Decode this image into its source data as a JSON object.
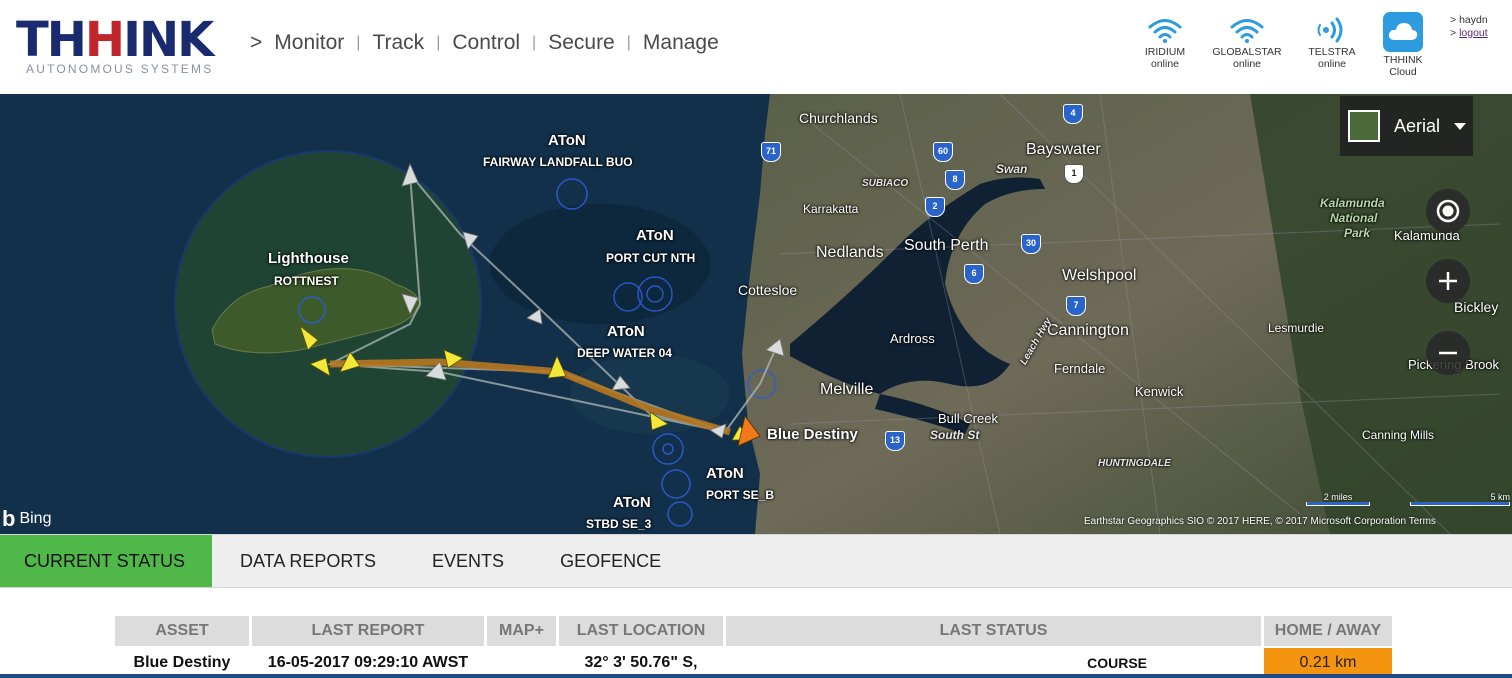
{
  "logo": {
    "name_blue_1": "TH",
    "name_red": "H",
    "name_blue_2": "INK",
    "subtitle": "AUTONOMOUS SYSTEMS"
  },
  "nav": {
    "arrow": ">",
    "items": [
      "Monitor",
      "Track",
      "Control",
      "Secure",
      "Manage"
    ],
    "separator": "|"
  },
  "networks": [
    {
      "name": "IRIDIUM",
      "status": "online",
      "icon": "wifi-icon"
    },
    {
      "name": "GLOBALSTAR",
      "status": "online",
      "icon": "wifi-icon"
    },
    {
      "name": "TELSTRA",
      "status": "online",
      "icon": "broadcast-icon"
    },
    {
      "name": "THHINK",
      "status": "Cloud",
      "icon": "cloud-icon"
    }
  ],
  "user": {
    "name": "haydn",
    "logout_marker": ">",
    "logout": "logout"
  },
  "map": {
    "map_type": "Aerial",
    "provider": "Bing",
    "copyright": "Earthstar Geographics SIO © 2017 HERE, © 2017 Microsoft Corporation  Terms",
    "scale_miles": "2 miles",
    "scale_km": "5 km",
    "aton_label": "AToN",
    "markers": {
      "fairway": "FAIRWAY LANDFALL BUO",
      "port_cut": "PORT CUT NTH",
      "deep_water": "DEEP WATER 04",
      "port_se": "PORT SE_B",
      "stbd_se": "STBD SE_3",
      "lighthouse_title": "Lighthouse",
      "lighthouse_name": "ROTTNEST",
      "vessel": "Blue Destiny"
    },
    "places": {
      "churchlands": "Churchlands",
      "bayswater": "Bayswater",
      "swan": "Swan",
      "subiaco": "SUBIACO",
      "karrakatta": "Karrakatta",
      "nedlands": "Nedlands",
      "south_perth": "South Perth",
      "kalamunda_np_1": "Kalamunda",
      "kalamunda_np_2": "National",
      "kalamunda_np_3": "Park",
      "kalamunda": "Kalamunda",
      "cottesloe": "Cottesloe",
      "welshpool": "Welshpool",
      "bickley": "Bickley",
      "cannington": "Cannington",
      "lesmurdie": "Lesmurdie",
      "ardross": "Ardross",
      "pickering_brook": "Pickering Brook",
      "ferndale": "Ferndale",
      "melville": "Melville",
      "kenwick": "Kenwick",
      "bull_creek": "Bull Creek",
      "south_st": "South St",
      "canning_mills": "Canning Mills",
      "huntingdale": "HUNTINGDALE",
      "leach_hwy": "Leach Hwy"
    },
    "routes": [
      "4",
      "71",
      "60",
      "8",
      "1",
      "2",
      "30",
      "6",
      "7",
      "13"
    ]
  },
  "tabs": [
    "CURRENT STATUS",
    "DATA REPORTS",
    "EVENTS",
    "GEOFENCE"
  ],
  "table": {
    "headers": [
      "ASSET",
      "LAST REPORT",
      "MAP+",
      "LAST LOCATION",
      "LAST STATUS",
      "HOME / AWAY"
    ],
    "rows": [
      {
        "asset": "Blue Destiny",
        "last_report": "16-05-2017 09:29:10 AWST",
        "map": "",
        "last_location": "32° 3' 50.76\" S,",
        "last_status": "COURSE",
        "home_away": "0.21 km"
      }
    ]
  },
  "colors": {
    "active_tab": "#4fb848",
    "away_cell": "#f5940f",
    "brand_blue": "#1a2a6e",
    "brand_red": "#c0262c"
  }
}
